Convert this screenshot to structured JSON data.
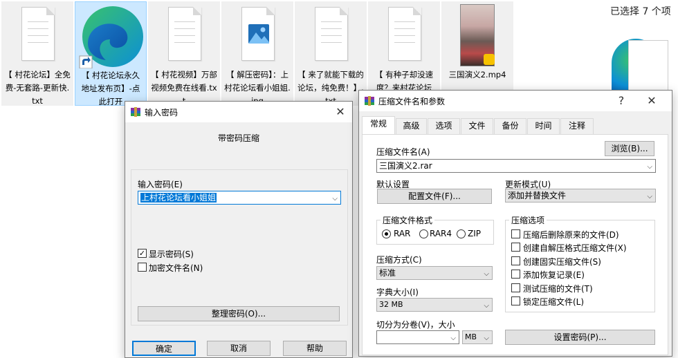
{
  "explorer": {
    "selection_count": "已选择 7 个项",
    "files": [
      {
        "name": "【 村花论坛】全免费-无套路-更新快.txt",
        "icon": "text-file-icon"
      },
      {
        "name": "【 村花论坛永久地址发布页】-点此打开",
        "icon": "edge-shortcut-icon"
      },
      {
        "name": "【 村花视频】万部视频免费在线看.txt",
        "icon": "text-file-icon"
      },
      {
        "name": "【 解压密码】：上村花论坛看小姐姐.jpg",
        "icon": "image-file-icon"
      },
      {
        "name": "【 来了就能下载的论坛，纯免费！】.txt",
        "icon": "text-file-icon"
      },
      {
        "name": "【 有种子却没速度？来村花论坛",
        "icon": "text-file-icon"
      },
      {
        "name": "三国演义2.mp4",
        "icon": "video-thumbnail-icon"
      }
    ]
  },
  "password_dialog": {
    "title": "输入密码",
    "heading": "带密码压缩",
    "password_label": "输入密码(E)",
    "password_value": "上村花论坛看小姐姐",
    "show_password_label": "显示密码(S)",
    "show_password_checked": true,
    "encrypt_names_label": "加密文件名(N)",
    "encrypt_names_checked": false,
    "organize_button": "整理密码(O)...",
    "ok_button": "确定",
    "cancel_button": "取消",
    "help_button": "帮助"
  },
  "archive_dialog": {
    "title": "压缩文件名和参数",
    "help_glyph": "?",
    "tabs": [
      "常规",
      "高级",
      "选项",
      "文件",
      "备份",
      "时间",
      "注释"
    ],
    "active_tab": "常规",
    "archive_name_label": "压缩文件名(A)",
    "browse_button": "浏览(B)...",
    "archive_name_value": "三国演义2.rar",
    "default_settings_label": "默认设置",
    "profiles_button": "配置文件(F)...",
    "update_mode_label": "更新模式(U)",
    "update_mode_value": "添加并替换文件",
    "format_group": "压缩文件格式",
    "formats": [
      "RAR",
      "RAR4",
      "ZIP"
    ],
    "selected_format": "RAR",
    "method_label": "压缩方式(C)",
    "method_value": "标准",
    "dict_label": "字典大小(I)",
    "dict_value": "32 MB",
    "split_label": "切分为分卷(V)，大小",
    "split_value": "",
    "split_unit": "MB",
    "options_group": "压缩选项",
    "options": [
      {
        "label": "压缩后删除原来的文件(D)",
        "checked": false
      },
      {
        "label": "创建自解压格式压缩文件(X)",
        "checked": false
      },
      {
        "label": "创建固实压缩文件(S)",
        "checked": false
      },
      {
        "label": "添加恢复记录(E)",
        "checked": false
      },
      {
        "label": "测试压缩的文件(T)",
        "checked": false
      },
      {
        "label": "锁定压缩文件(L)",
        "checked": false
      }
    ],
    "set_password_button": "设置密码(P)..."
  }
}
